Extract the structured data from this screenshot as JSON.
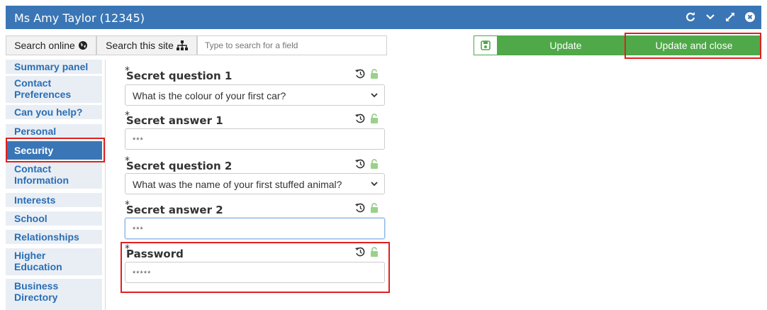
{
  "window": {
    "title": "Ms Amy Taylor (12345)",
    "tools": [
      "refresh-icon",
      "chevron-down-icon",
      "expand-icon",
      "close-icon"
    ]
  },
  "toolbar": {
    "search_online": "Search online",
    "search_site": "Search this site",
    "search_placeholder": "Type to search for a field",
    "update": "Update",
    "update_close": "Update and close"
  },
  "sidebar": {
    "items": [
      {
        "label": "Summary panel"
      },
      {
        "label": "Contact Preferences"
      },
      {
        "label": "Can you help?"
      },
      {
        "label": "Personal"
      },
      {
        "label": "Security",
        "active": true
      },
      {
        "label": "Contact Information"
      },
      {
        "label": "Interests"
      },
      {
        "label": "School"
      },
      {
        "label": "Relationships"
      },
      {
        "label": "Higher Education"
      },
      {
        "label": "Business Directory"
      }
    ]
  },
  "form": {
    "required_mark": "*",
    "fields": [
      {
        "label": "Secret question 1",
        "type": "select",
        "value": "What is the colour of your first car?"
      },
      {
        "label": "Secret answer 1",
        "type": "password",
        "value": "***"
      },
      {
        "label": "Secret question 2",
        "type": "select",
        "value": "What was the name of your first stuffed animal?"
      },
      {
        "label": "Secret answer 2",
        "type": "password",
        "value": "***",
        "focused": true
      },
      {
        "label": "Password",
        "type": "password",
        "value": "*****"
      }
    ]
  },
  "colors": {
    "titlebar": "#3a76b5",
    "green": "#4fa949",
    "highlight": "#e02020",
    "nav_bg": "#e9eef5",
    "nav_text": "#2a6eb3",
    "lock": "#9bd08c"
  }
}
